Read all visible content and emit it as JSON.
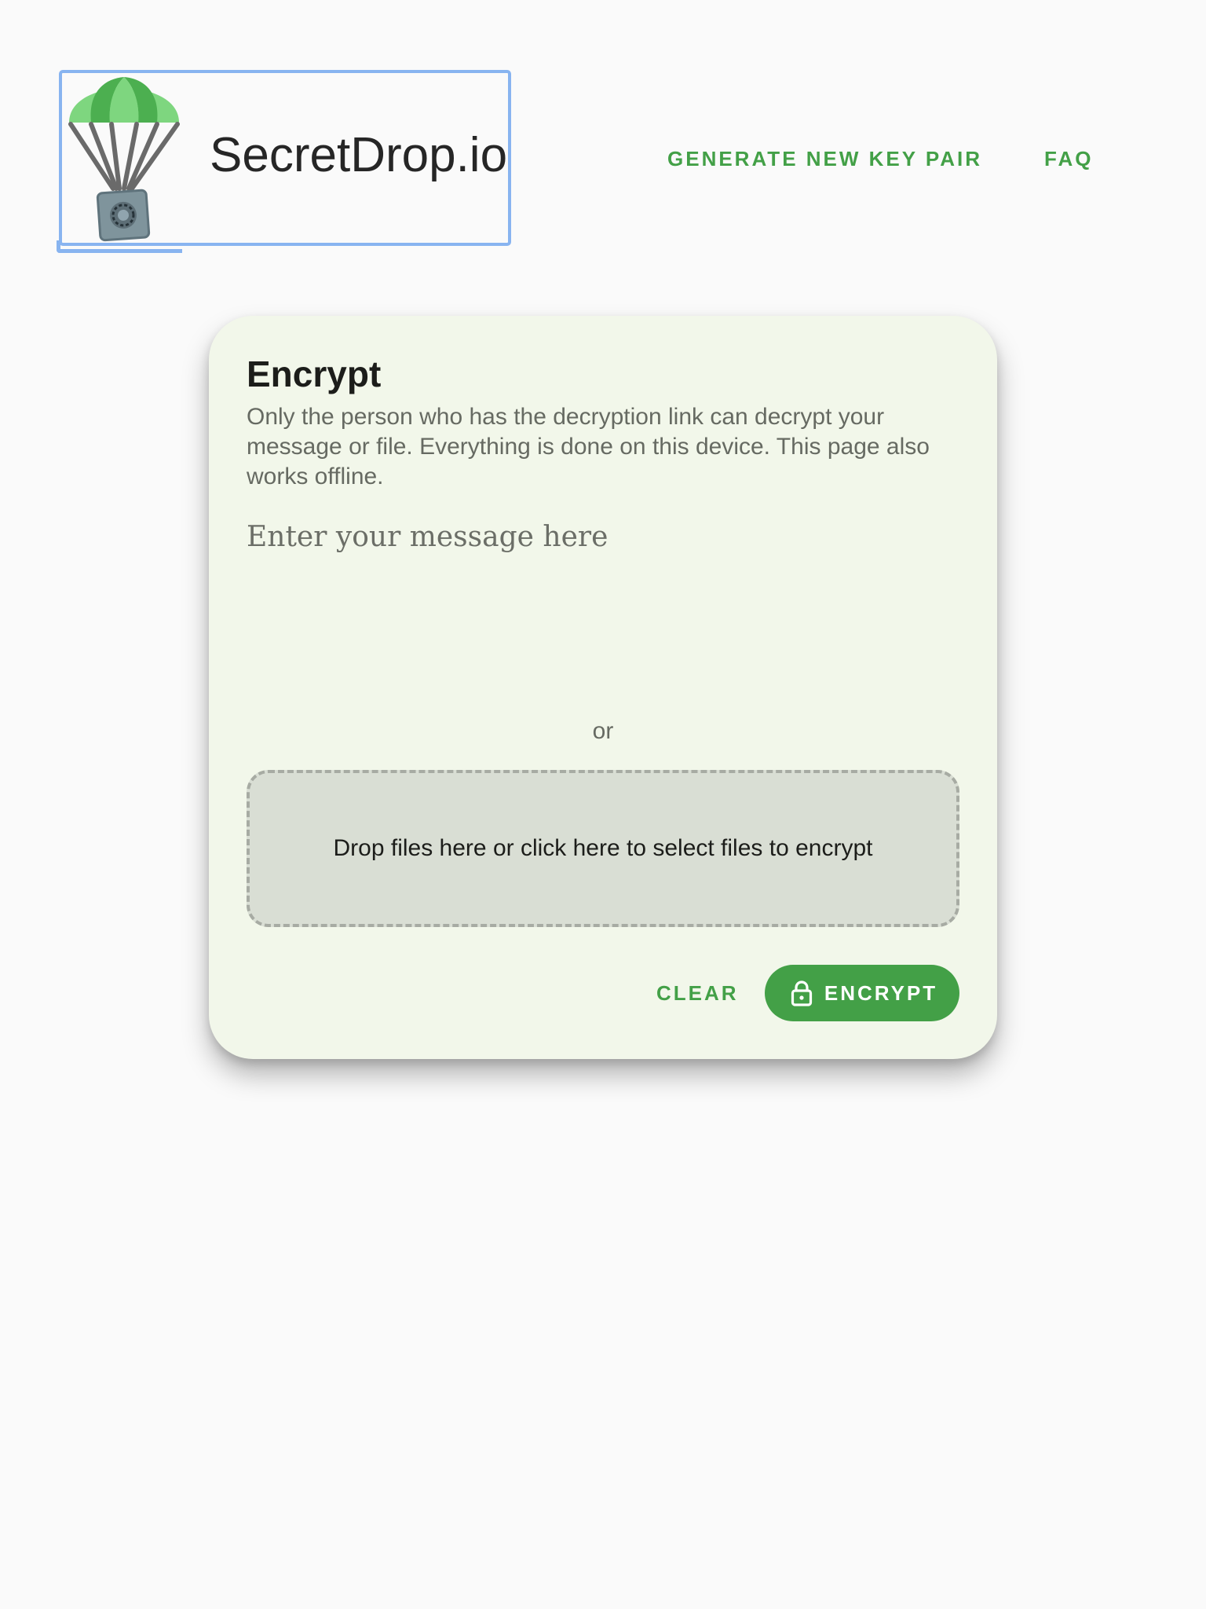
{
  "header": {
    "logo_text": "SecretDrop.io",
    "logo_icon": "parachute-safe-icon",
    "nav": [
      {
        "label": "GENERATE NEW KEY PAIR"
      },
      {
        "label": "FAQ"
      }
    ]
  },
  "encrypt_card": {
    "title": "Encrypt",
    "description": "Only the person who has the decryption link can decrypt your message or file. Everything is done on this device. This page also works offline.",
    "message_placeholder": "Enter your message here",
    "message_value": "",
    "or_label": "or",
    "dropzone_text": "Drop files here or click here to select files to encrypt",
    "clear_label": "CLEAR",
    "encrypt_label": "ENCRYPT",
    "encrypt_icon": "lock-icon"
  },
  "colors": {
    "accent": "#43a047",
    "page_background": "#fafafa",
    "card_background": "#f2f7ea",
    "dropzone_background": "#d9ded4",
    "focus_outline": "#88b4f0"
  }
}
